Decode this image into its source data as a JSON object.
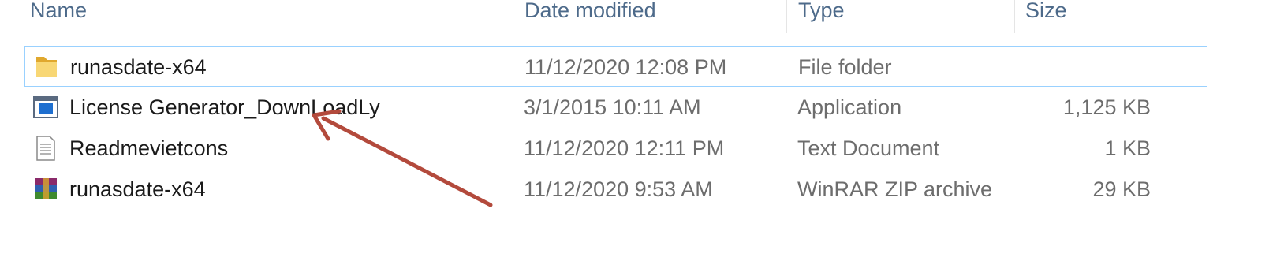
{
  "columns": {
    "name": "Name",
    "date": "Date modified",
    "type": "Type",
    "size": "Size"
  },
  "files": [
    {
      "name": "runasdate-x64",
      "date": "11/12/2020 12:08 PM",
      "type": "File folder",
      "size": "",
      "icon": "folder-icon",
      "selected": true
    },
    {
      "name": "License Generator_DownLoadLy",
      "date": "3/1/2015 10:11 AM",
      "type": "Application",
      "size": "1,125 KB",
      "icon": "application-icon",
      "selected": false
    },
    {
      "name": "Readmevietcons",
      "date": "11/12/2020 12:11 PM",
      "type": "Text Document",
      "size": "1 KB",
      "icon": "text-document-icon",
      "selected": false
    },
    {
      "name": "runasdate-x64",
      "date": "11/12/2020 9:53 AM",
      "type": "WinRAR ZIP archive",
      "size": "29 KB",
      "icon": "winrar-archive-icon",
      "selected": false
    }
  ],
  "annotation": {
    "color": "#b34a3c",
    "icon": "red-arrow-annotation"
  }
}
